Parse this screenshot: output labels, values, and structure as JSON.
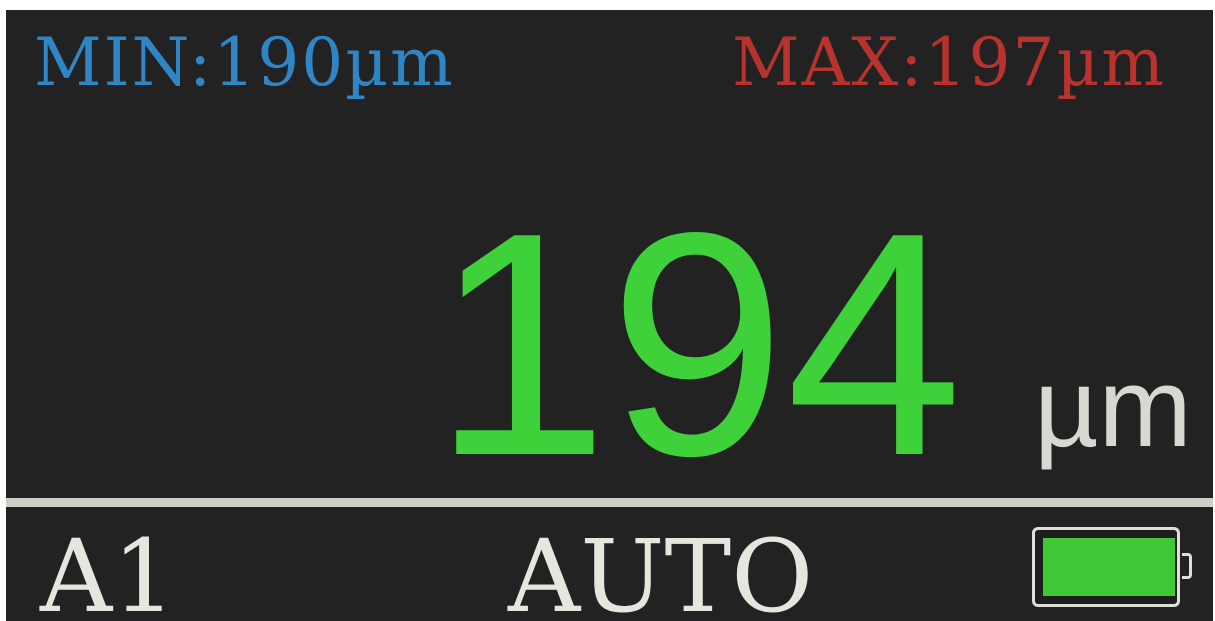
{
  "display": {
    "min_reading": "MIN:190µm",
    "max_reading": "MAX:197µm",
    "current_value": "194",
    "current_unit": "µm"
  },
  "status_bar": {
    "channel": "A1",
    "mode": "AUTO",
    "battery_level": 1.0
  },
  "colors": {
    "background": "#222222",
    "min_color": "#2f86c6",
    "max_color": "#b8332d",
    "value_color": "#3fd13a",
    "text_color": "#e6e6df",
    "battery_color": "#41c837"
  },
  "icons": {
    "battery": "battery-icon"
  }
}
